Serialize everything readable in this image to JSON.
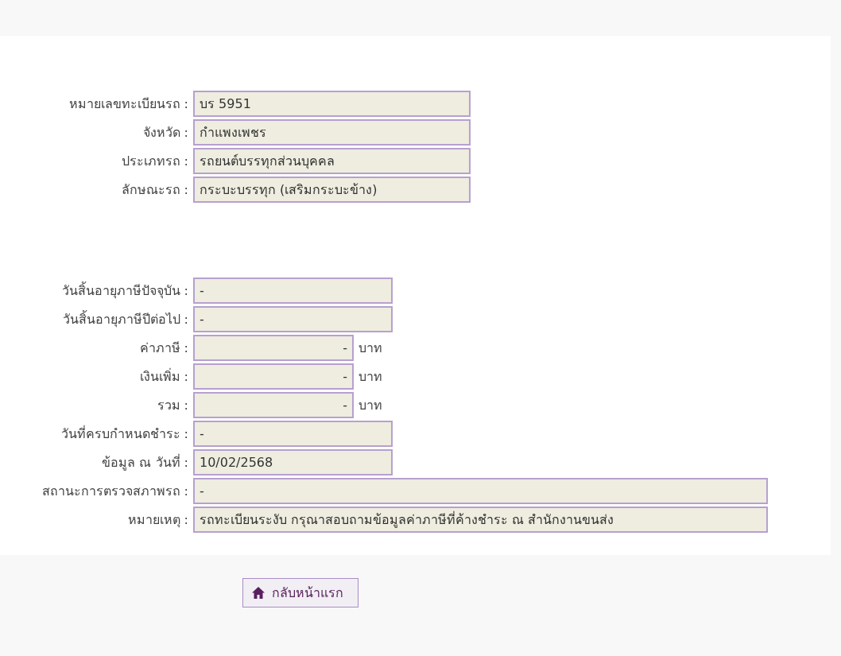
{
  "vehicle_section": {
    "fields": [
      {
        "label": "หมายเลขทะเบียนรถ :",
        "value": "บร 5951",
        "kind": "large"
      },
      {
        "label": "จังหวัด :",
        "value": "กำแพงเพชร",
        "kind": "large"
      },
      {
        "label": "ประเภทรถ :",
        "value": "รถยนต์บรรทุกส่วนบุคคล",
        "kind": "large"
      },
      {
        "label": "ลักษณะรถ :",
        "value": "กระบะบรรทุก (เสริมกระบะข้าง)",
        "kind": "large"
      }
    ]
  },
  "tax_section": {
    "fields": [
      {
        "label": "วันสิ้นอายุภาษีปัจจุบัน :",
        "value": "-",
        "kind": "medium"
      },
      {
        "label": "วันสิ้นอายุภาษีปีต่อไป :",
        "value": "-",
        "kind": "medium"
      },
      {
        "label": "ค่าภาษี :",
        "value": "-",
        "kind": "amount",
        "unit": "บาท"
      },
      {
        "label": "เงินเพิ่ม :",
        "value": "-",
        "kind": "amount",
        "unit": "บาท"
      },
      {
        "label": "รวม :",
        "value": "-",
        "kind": "amount",
        "unit": "บาท"
      },
      {
        "label": "วันที่ครบกำหนดชำระ :",
        "value": "-",
        "kind": "medium"
      },
      {
        "label": "ข้อมูล ณ วันที่ :",
        "value": "10/02/2568",
        "kind": "medium"
      },
      {
        "label": "สถานะการตรวจสภาพรถ :",
        "value": "-",
        "kind": "full"
      },
      {
        "label": "หมายเหตุ :",
        "value": "รถทะเบียนระงับ กรุณาสอบถามข้อมูลค่าภาษีที่ค้างชำระ ณ สำนักงานขนส่ง",
        "kind": "full"
      }
    ]
  },
  "home_button": {
    "label": "กลับหน้าแรก"
  }
}
